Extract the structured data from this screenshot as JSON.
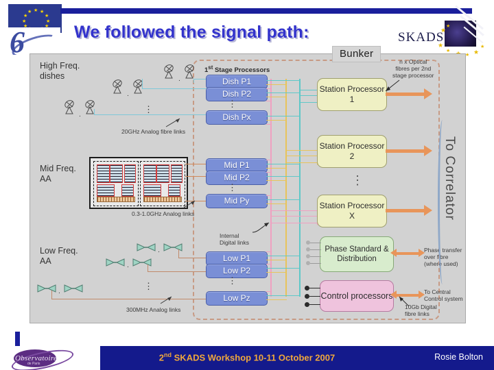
{
  "header": {
    "title": "We followed the signal path:",
    "eu_logo_name": "eu-flag-logo",
    "fp6_logo_text": "6",
    "skads_text": "SKADS"
  },
  "diagram": {
    "bunker_label": "Bunker",
    "left_labels": {
      "high_freq": "High Freq.\ndishes",
      "mid_freq": "Mid Freq.\nAA",
      "low_freq": "Low Freq.\nAA"
    },
    "link_annotations": {
      "dish_links": "20GHz Analog fibre links",
      "mid_links": "0.3-1.0GHz Analog links",
      "low_links": "300MHz Analog links",
      "internal_links": "Internal\nDigital links",
      "optical_fibres": "n x  Optical\nfibres per 2nd\nstage processor",
      "phase_transfer": "Phase transfer\nover fibre (where used)",
      "central_control": "To Central\nControl system",
      "digital_fibre": "10Gb Digital\nfibre links"
    },
    "stage1_heading": "1st Stage Processors",
    "stage1_processors": [
      "Dish P1",
      "Dish P2",
      "Dish Px",
      "Mid P1",
      "Mid P2",
      "Mid Py",
      "Low P1",
      "Low P2",
      "Low Pz"
    ],
    "station_processors": [
      "Station Processor 1",
      "Station Processor 2",
      "Station Processor X"
    ],
    "phase_box": "Phase Standard & Distribution",
    "control_box": "Control processors",
    "correlator_label": "To Correlator",
    "colors": {
      "panel_bg": "#d2d2d2",
      "processor_pill": "#7a8fd6",
      "station_box": "#eff0c4",
      "phase_box": "#d8eccd",
      "control_box": "#efc3dd",
      "bunker_dash": "#c79a84",
      "arrow_orange": "#e8955a",
      "dish_link": "#7ec8d8",
      "mid_link": "#d08a5a"
    }
  },
  "footer": {
    "event": "SKADS Workshop  10-11 October 2007",
    "event_ordinal_num": "2",
    "event_ordinal_sup": "nd",
    "author": "Rosie Bolton",
    "logo_text": "Observatoire",
    "logo_sub": "de Paris"
  }
}
